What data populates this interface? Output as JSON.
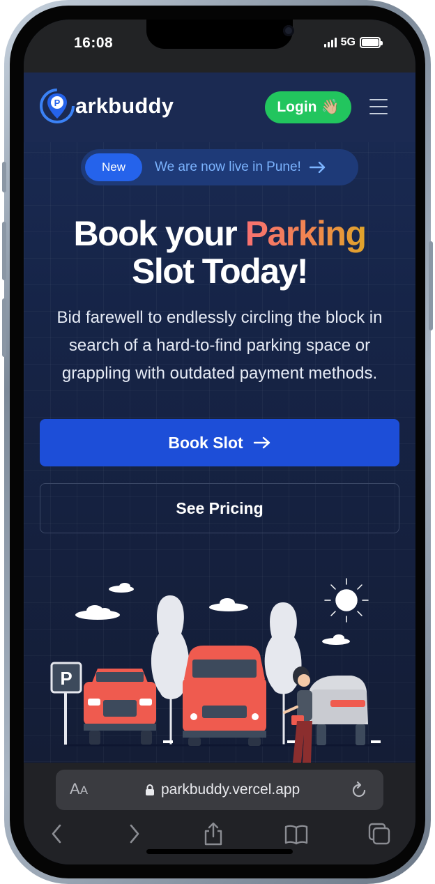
{
  "status_bar": {
    "time": "16:08",
    "network": "5G",
    "battery_level": 1.0
  },
  "header": {
    "logo_text": "arkbuddy",
    "login_label": "Login",
    "login_emoji": "👋🏼"
  },
  "announcement": {
    "badge": "New",
    "text": "We are now live in Pune!"
  },
  "hero": {
    "title_part1": "Book your ",
    "title_accent": "Parking",
    "title_part2": "Slot Today!",
    "subtitle": "Bid farewell to endlessly circling the block in search of a hard-to-find parking space or grappling with outdated payment methods."
  },
  "buttons": {
    "book_slot": "Book Slot",
    "see_pricing": "See Pricing"
  },
  "illustration": {
    "parking_sign": "P"
  },
  "browser": {
    "text_size_label": "A",
    "text_size_label_small": "A",
    "url": "parkbuddy.vercel.app"
  },
  "colors": {
    "page_background": "#162447",
    "header_background": "#1b2a52",
    "login_green": "#22c55e",
    "primary_blue": "#1d4ed8",
    "accent_gradient_start": "#f87171",
    "accent_gradient_end": "#e0a52a",
    "announcement_text": "#7cb4ff",
    "car_red": "#ef5b4f"
  },
  "icons": {
    "logo": "parking-location-pin-icon",
    "menu": "hamburger-menu-icon",
    "announcement_arrow": "arrow-right-icon",
    "book_arrow": "arrow-right-icon",
    "lock": "lock-icon",
    "reload": "reload-icon",
    "back": "chevron-left-icon",
    "forward": "chevron-right-icon",
    "share": "share-icon",
    "bookmarks": "book-icon",
    "tabs": "tabs-icon"
  }
}
